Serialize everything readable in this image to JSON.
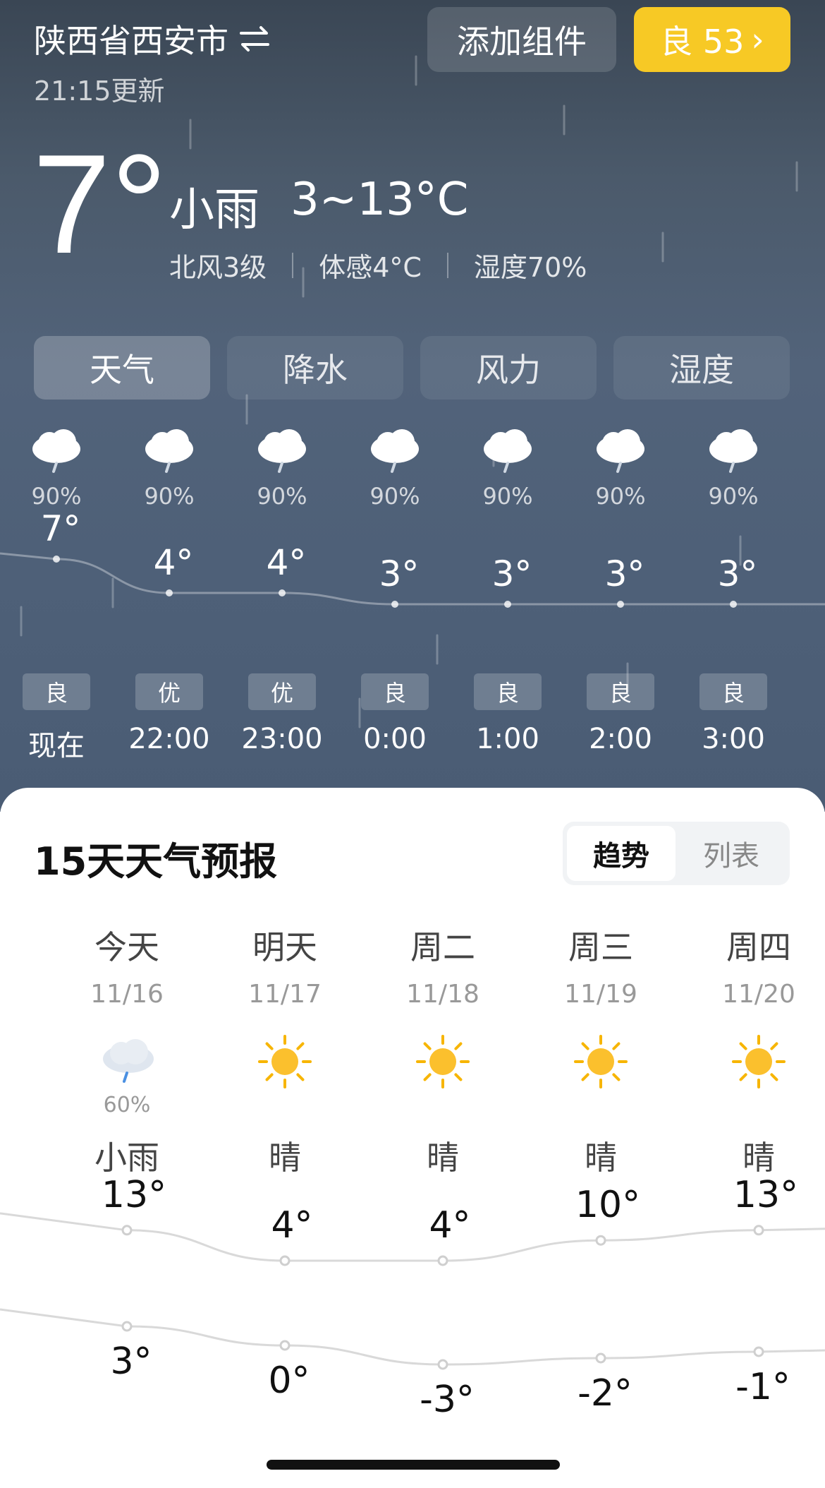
{
  "header": {
    "location": "陕西省西安市",
    "updated": "21:15更新",
    "add_widget": "添加组件",
    "aqi_badge": "良 53"
  },
  "current": {
    "temp": "7°",
    "condition": "小雨",
    "range": "3~13°C",
    "wind": "北风3级",
    "feels": "体感4°C",
    "humidity": "湿度70%"
  },
  "tabs": [
    "天气",
    "降水",
    "风力",
    "湿度"
  ],
  "hourly": [
    {
      "pct": "90%",
      "temp": "7°",
      "aqi": "良",
      "time": "现在",
      "t": 7
    },
    {
      "pct": "90%",
      "temp": "4°",
      "aqi": "优",
      "time": "22:00",
      "t": 4
    },
    {
      "pct": "90%",
      "temp": "4°",
      "aqi": "优",
      "time": "23:00",
      "t": 4
    },
    {
      "pct": "90%",
      "temp": "3°",
      "aqi": "良",
      "time": "0:00",
      "t": 3
    },
    {
      "pct": "90%",
      "temp": "3°",
      "aqi": "良",
      "time": "1:00",
      "t": 3
    },
    {
      "pct": "90%",
      "temp": "3°",
      "aqi": "良",
      "time": "2:00",
      "t": 3
    },
    {
      "pct": "90%",
      "temp": "3°",
      "aqi": "良",
      "time": "3:00",
      "t": 3
    }
  ],
  "forecast": {
    "title": "15天天气预报",
    "view_trend": "趋势",
    "view_list": "列表",
    "days": [
      {
        "name": "今天",
        "date": "11/16",
        "icon": "rain-cloud-icon",
        "pct": "60%",
        "cond": "小雨",
        "high": "13°",
        "low": "3°",
        "h": 13,
        "l": 3
      },
      {
        "name": "明天",
        "date": "11/17",
        "icon": "sun-icon",
        "pct": "",
        "cond": "晴",
        "high": "4°",
        "low": "0°",
        "h": 4,
        "l": 0
      },
      {
        "name": "周二",
        "date": "11/18",
        "icon": "sun-icon",
        "pct": "",
        "cond": "晴",
        "high": "4°",
        "low": "-3°",
        "h": 4,
        "l": -3
      },
      {
        "name": "周三",
        "date": "11/19",
        "icon": "sun-icon",
        "pct": "",
        "cond": "晴",
        "high": "10°",
        "low": "-2°",
        "h": 10,
        "l": -2
      },
      {
        "name": "周四",
        "date": "11/20",
        "icon": "sun-icon",
        "pct": "",
        "cond": "晴",
        "high": "13°",
        "low": "-1°",
        "h": 13,
        "l": -1
      }
    ]
  },
  "colors": {
    "accent_yellow": "#f7c925",
    "sky_dark": "#3a4654",
    "sky_mid": "#52637a"
  }
}
